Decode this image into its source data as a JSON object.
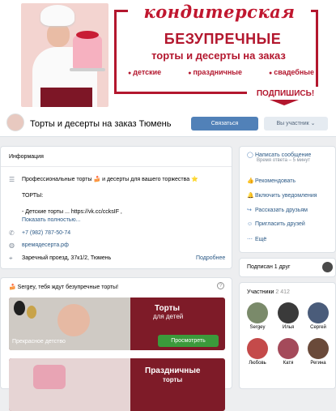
{
  "cover": {
    "brand": "кондитерская",
    "headline1": "БЕЗУПРЕЧНЫЕ",
    "headline2": "торты и десерты на заказ",
    "categories": [
      "детские",
      "праздничные",
      "свадебные"
    ],
    "subscribe": "ПОДПИШИСЬ!"
  },
  "header": {
    "title": "Торты и десерты на заказ Тюмень",
    "join_label": "Связаться",
    "member_label": "Вы участник"
  },
  "info": {
    "title": "Информация",
    "description": "Профессиональные торты 🍰 и десерты для вашего торжества ⭐",
    "description_subtitle": "ТОРТЫ:",
    "kids_line": "- Детские торты ...",
    "kids_link": "https://vk.cc/ccksIF ,",
    "show_more": "Показать полностью...",
    "phone": "+7 (982) 787-50-74",
    "site": "времядесерта.рф",
    "address": "Заречный проезд, 37к1/2, Тюмень",
    "details": "Подробнее"
  },
  "actions": {
    "message": "Написать сообщение",
    "reply_time": "Время ответа – 5 минут",
    "recommend": "Рекомендовать",
    "notifications": "Включить уведомления",
    "tell_friends": "Рассказать друзьям",
    "invite": "Пригласить друзей",
    "more": "Ещё"
  },
  "follow": {
    "text": "Подписан 1 друг"
  },
  "members": {
    "label": "Участники",
    "count": "2 412",
    "list": [
      {
        "name": "Sergey",
        "color": "#7a8a6a"
      },
      {
        "name": "Илья",
        "color": "#3a3a3a"
      },
      {
        "name": "Сергей",
        "color": "#4a5c7a"
      },
      {
        "name": "Любовь",
        "color": "#c44a4a"
      },
      {
        "name": "Катя",
        "color": "#a44a5a"
      },
      {
        "name": "Регина",
        "color": "#6a4a3a"
      }
    ]
  },
  "posts": {
    "greeting": "🍰 Sergey, тебя ждут безупречные торты!",
    "banner1": {
      "title1": "Торты",
      "title2": "для детей",
      "caption": "Прекрасное детство",
      "button": "Просмотреть"
    },
    "banner2": {
      "title1": "Праздничные",
      "title2": "торты"
    }
  },
  "colors": {
    "brand": "#b3172e",
    "accent": "#5181b8"
  }
}
